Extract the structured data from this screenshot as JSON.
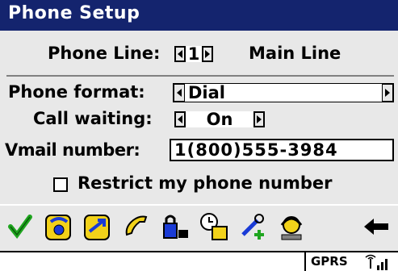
{
  "window": {
    "title": "Phone Setup"
  },
  "phone_line": {
    "label": "Phone Line:",
    "value": "1",
    "name": "Main Line"
  },
  "phone_format": {
    "label": "Phone format:",
    "value": "Dial"
  },
  "call_waiting": {
    "label": "Call waiting:",
    "value": "On"
  },
  "vmail": {
    "label": "Vmail number:",
    "value": "1(800)555-3984"
  },
  "restrict": {
    "label": "Restrict my phone number",
    "checked": false
  },
  "toolbar": {
    "items": [
      "checkmark-icon",
      "phone-settings-icon",
      "forward-icon",
      "call-handset-icon",
      "lock-keypad-icon",
      "call-timer-icon",
      "tools-add-icon",
      "operator-icon",
      "back-arrow-icon"
    ]
  },
  "status": {
    "network": "GPRS"
  },
  "colors": {
    "title_bg": "#14246e",
    "check_green": "#1fa51f",
    "icon_yellow": "#f2d21a",
    "icon_blue": "#1a3bd6"
  }
}
